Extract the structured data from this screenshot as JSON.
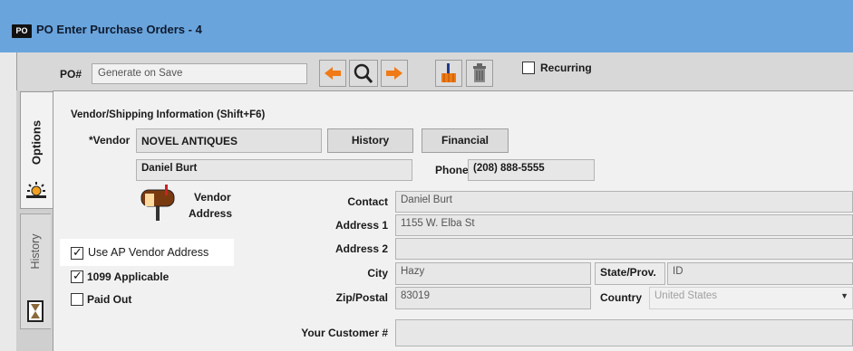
{
  "window": {
    "badge": "PO",
    "title": "PO Enter Purchase Orders - 4"
  },
  "toolbar": {
    "po_label": "PO#",
    "po_placeholder": "Generate on Save",
    "recurring_label": "Recurring"
  },
  "tabs": {
    "options": "Options",
    "history": "History"
  },
  "vendor_section": {
    "heading": "Vendor/Shipping Information (Shift+F6)",
    "vendor_label": "*Vendor",
    "vendor_name": "NOVEL ANTIQUES",
    "history_button": "History",
    "financial_button": "Financial",
    "contact_name": "Daniel Burt",
    "phone_label": "Phone",
    "phone_value": "(208) 888-5555",
    "vendor_address_label_1": "Vendor",
    "vendor_address_label_2": "Address"
  },
  "address": {
    "contact_label": "Contact",
    "contact_value": "Daniel Burt",
    "address1_label": "Address 1",
    "address1_value": "1155 W. Elba St",
    "address2_label": "Address 2",
    "address2_value": "",
    "city_label": "City",
    "city_value": "Hazy",
    "state_label": "State/Prov.",
    "state_value": "ID",
    "zip_label": "Zip/Postal",
    "zip_value": "83019",
    "country_label": "Country",
    "country_value": "United States",
    "customer_label": "Your Customer #",
    "customer_value": ""
  },
  "checkboxes": {
    "use_ap_vendor_address": {
      "label": "Use AP Vendor Address",
      "checked": true
    },
    "applicable_1099": {
      "label": "1099 Applicable",
      "checked": true
    },
    "paid_out": {
      "label": "Paid Out",
      "checked": false
    }
  },
  "icons": {
    "prev": "arrow-left-icon",
    "search": "magnifier-icon",
    "next": "arrow-right-icon",
    "clear": "broom-icon",
    "delete": "trash-icon",
    "mailbox": "mailbox-icon",
    "options": "sun-icon",
    "history": "hourglass-icon"
  },
  "colors": {
    "titlebar": "#6aa4dc",
    "arrow": "#f07a16",
    "panel": "#f1f1f1"
  }
}
